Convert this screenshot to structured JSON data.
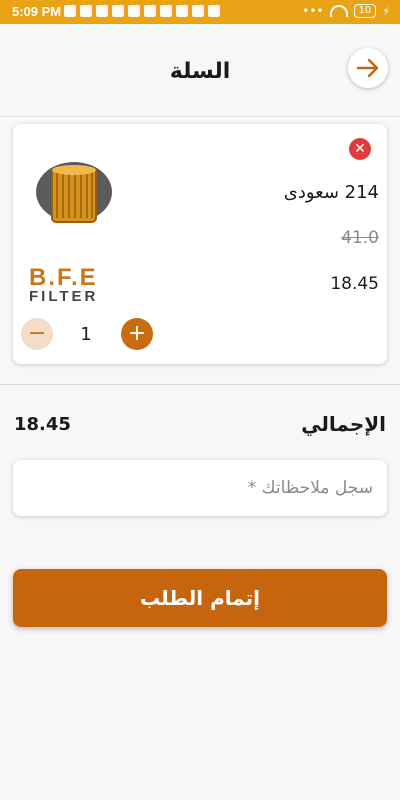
{
  "status_bar": {
    "time": "5:09 PM",
    "battery": "10"
  },
  "header": {
    "title": "السلة"
  },
  "cart": {
    "items": [
      {
        "name": "214 سعودى",
        "old_price": "41.0",
        "price": "18.45",
        "quantity": "1",
        "logo_line1": "B.F.E",
        "logo_line2": "FILTER"
      }
    ]
  },
  "summary": {
    "total_label": "الإجمالي",
    "total_value": "18.45"
  },
  "notes": {
    "placeholder": "سجل ملاحظاتك *"
  },
  "actions": {
    "checkout_label": "إتمام الطلب"
  },
  "colors": {
    "accent": "#c7650f",
    "status_bar": "#e8a317",
    "remove": "#e23b3b"
  }
}
